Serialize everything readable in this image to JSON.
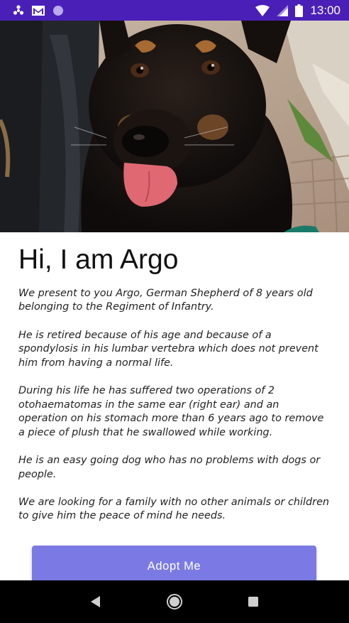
{
  "status_bar": {
    "time": "13:00",
    "icons": [
      "fan-icon",
      "gmail-icon",
      "circle-icon",
      "wifi-icon",
      "signal-icon",
      "battery-icon"
    ]
  },
  "hero": {
    "subject": "dog-photo"
  },
  "profile": {
    "title": "Hi, I am Argo",
    "paragraphs": [
      "We present to you Argo, German Shepherd of 8 years old belonging to the Regiment of Infantry.",
      "He is retired because of his age and because of a spondylosis in his lumbar vertebra which does not prevent him from having a normal life.",
      "During his life he has suffered two operations of 2 otohaematomas in the same ear (right ear) and an operation on his stomach more than 6 years ago to remove a piece of plush that he swallowed while working.",
      "He is an easy going dog who has no problems with dogs or people.",
      "We are looking for a family with no other animals or children to give him the peace of mind he needs."
    ]
  },
  "actions": {
    "adopt_label": "Adopt Me"
  },
  "colors": {
    "status_bar": "#4a1fb8",
    "button": "#7b7ae4",
    "nav_bar": "#000000"
  }
}
